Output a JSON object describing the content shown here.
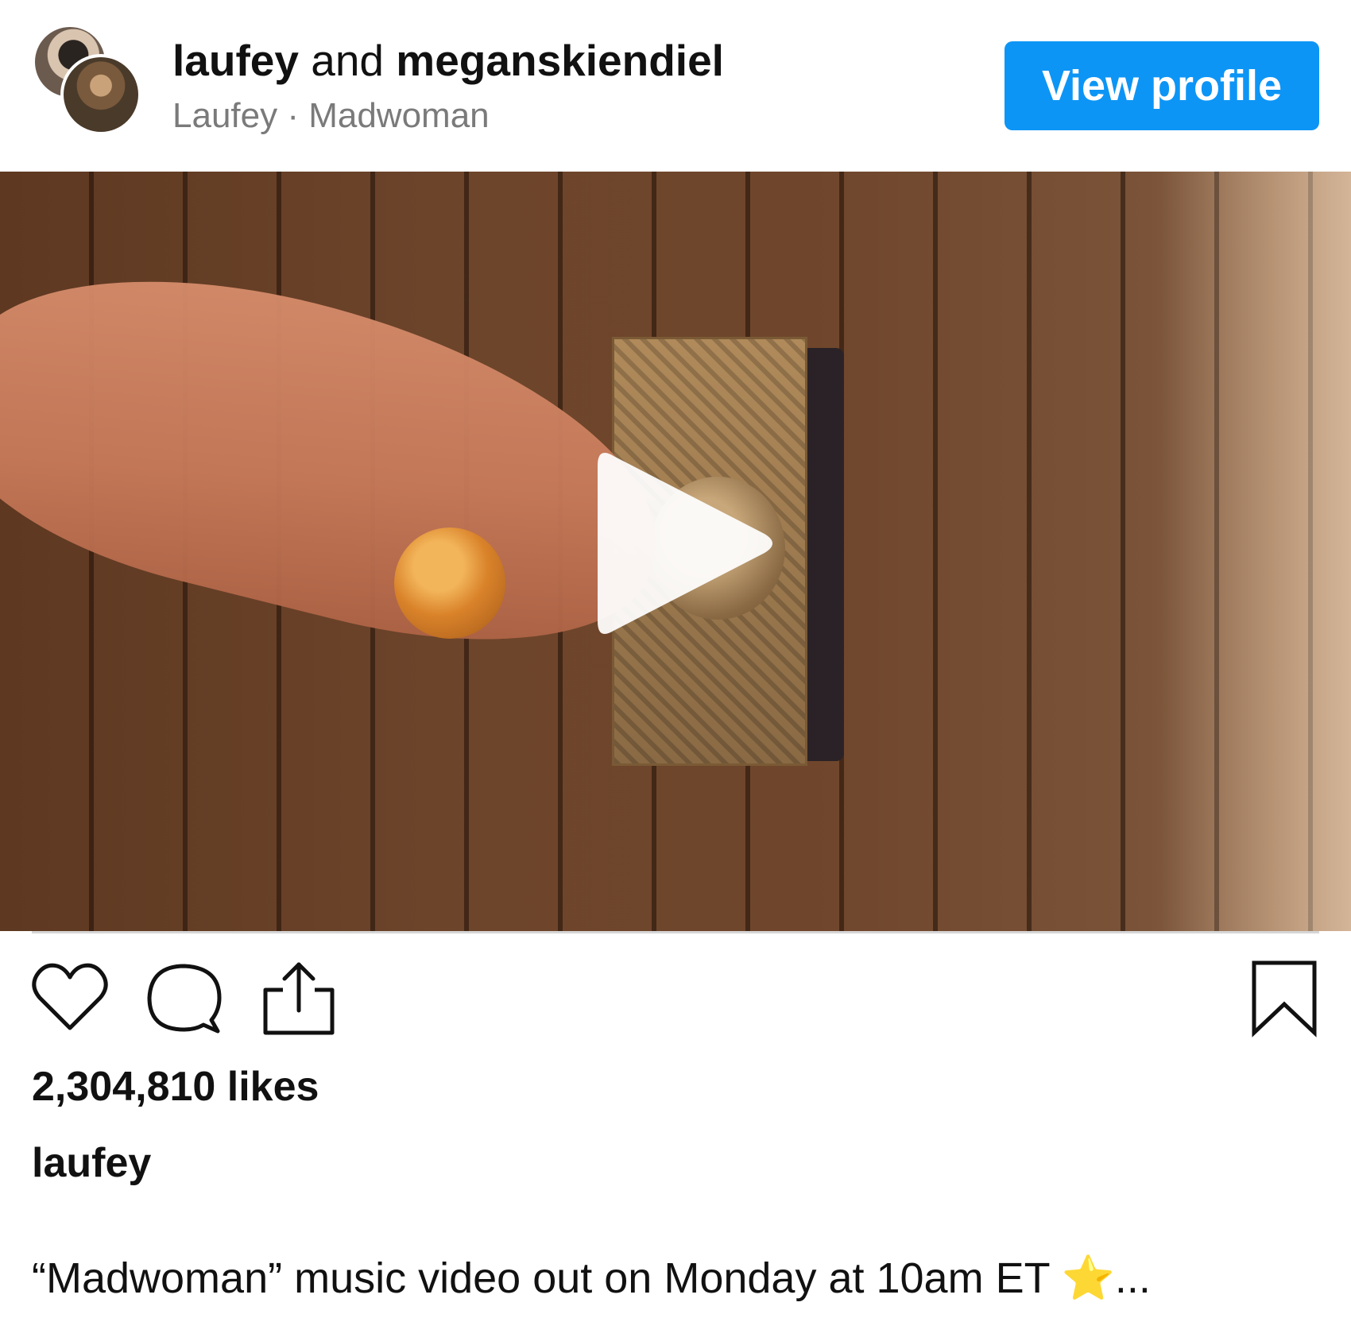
{
  "header": {
    "user_primary": "laufey",
    "joiner": " and ",
    "user_secondary": "meganskiendiel",
    "subtitle": "Laufey · Madwoman",
    "view_profile_label": "View profile",
    "button_color": "#0d95f5"
  },
  "media": {
    "type": "video",
    "play_icon": "play-icon"
  },
  "actions": {
    "icons": [
      "heart-icon",
      "comment-icon",
      "share-icon",
      "bookmark-icon"
    ]
  },
  "post": {
    "likes": "2,304,810 likes",
    "caption_user": "laufey",
    "caption_text": "“Madwoman” music video out on Monday at 10am ET ",
    "caption_star": "⭐",
    "caption_more": "..."
  }
}
